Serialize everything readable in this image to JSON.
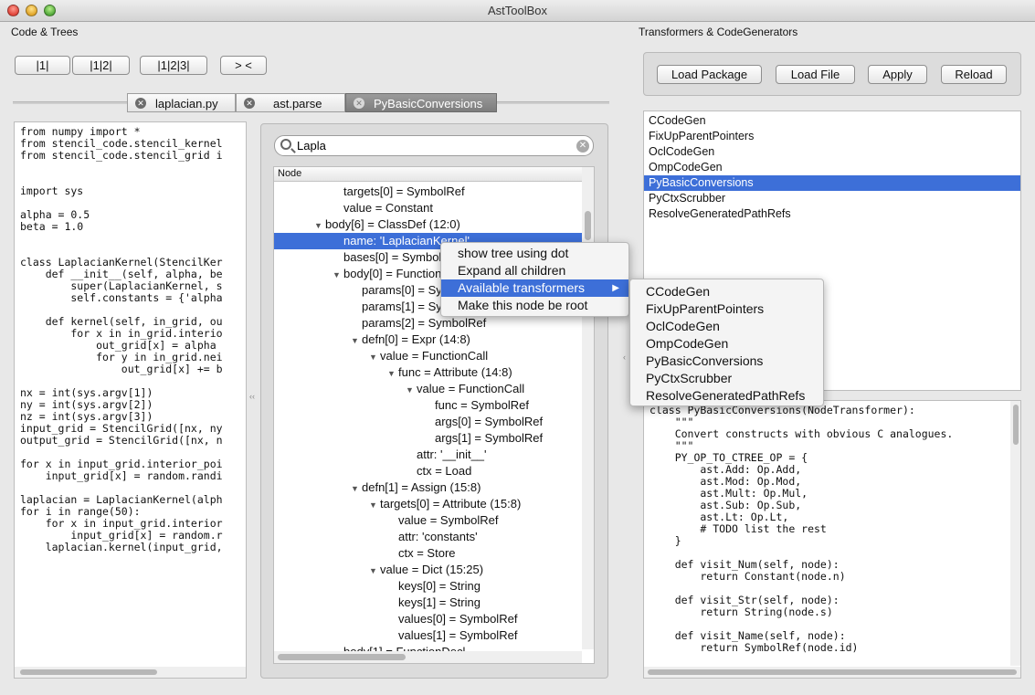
{
  "window": {
    "title": "AstToolBox"
  },
  "left": {
    "label": "Code & Trees",
    "buttons": [
      "|1|",
      "|1|2|",
      "|1|2|3|",
      ">  <"
    ],
    "tabs": [
      {
        "label": "laplacian.py",
        "active": false
      },
      {
        "label": "ast.parse",
        "active": false
      },
      {
        "label": "PyBasicConversions",
        "active": true
      }
    ],
    "code_lines": [
      "from numpy import *",
      "from stencil_code.stencil_kernel",
      "from stencil_code.stencil_grid i",
      "",
      "",
      "import sys",
      "",
      "alpha = 0.5",
      "beta = 1.0",
      "",
      "",
      "class LaplacianKernel(StencilKer",
      "    def __init__(self, alpha, be",
      "        super(LaplacianKernel, s",
      "        self.constants = {'alpha",
      "",
      "    def kernel(self, in_grid, ou",
      "        for x in in_grid.interio",
      "            out_grid[x] = alpha ",
      "            for y in in_grid.nei",
      "                out_grid[x] += b",
      "",
      "nx = int(sys.argv[1])",
      "ny = int(sys.argv[2])",
      "nz = int(sys.argv[3])",
      "input_grid = StencilGrid([nx, ny",
      "output_grid = StencilGrid([nx, n",
      "",
      "for x in input_grid.interior_poi",
      "    input_grid[x] = random.randi",
      "",
      "laplacian = LaplacianKernel(alph",
      "for i in range(50):",
      "    for x in input_grid.interior",
      "        input_grid[x] = random.r",
      "    laplacian.kernel(input_grid,"
    ]
  },
  "tree": {
    "search_value": "Lapla",
    "header": "Node",
    "rows": [
      {
        "text": "targets[0] = SymbolRef",
        "indent": 4,
        "toggle": ""
      },
      {
        "text": "value = Constant",
        "indent": 4,
        "toggle": ""
      },
      {
        "text": "body[6] = ClassDef (12:0)",
        "indent": 3,
        "toggle": "▼"
      },
      {
        "text": "name: 'LaplacianKernel'",
        "indent": 4,
        "toggle": "",
        "selected": true
      },
      {
        "text": "bases[0] = SymbolRef",
        "indent": 4,
        "toggle": ""
      },
      {
        "text": "body[0] = FunctionDecl",
        "indent": 4,
        "toggle": "▼"
      },
      {
        "text": "params[0] = SymbolRef",
        "indent": 5,
        "toggle": ""
      },
      {
        "text": "params[1] = SymbolRef",
        "indent": 5,
        "toggle": ""
      },
      {
        "text": "params[2] = SymbolRef",
        "indent": 5,
        "toggle": ""
      },
      {
        "text": "defn[0] = Expr (14:8)",
        "indent": 5,
        "toggle": "▼"
      },
      {
        "text": "value = FunctionCall",
        "indent": 6,
        "toggle": "▼"
      },
      {
        "text": "func = Attribute (14:8)",
        "indent": 7,
        "toggle": "▼"
      },
      {
        "text": "value = FunctionCall",
        "indent": 8,
        "toggle": "▼"
      },
      {
        "text": "func = SymbolRef",
        "indent": 9,
        "toggle": ""
      },
      {
        "text": "args[0] = SymbolRef",
        "indent": 9,
        "toggle": ""
      },
      {
        "text": "args[1] = SymbolRef",
        "indent": 9,
        "toggle": ""
      },
      {
        "text": "attr: '__init__'",
        "indent": 8,
        "toggle": ""
      },
      {
        "text": "ctx = Load",
        "indent": 8,
        "toggle": ""
      },
      {
        "text": "defn[1] = Assign (15:8)",
        "indent": 5,
        "toggle": "▼"
      },
      {
        "text": "targets[0] = Attribute (15:8)",
        "indent": 6,
        "toggle": "▼"
      },
      {
        "text": "value = SymbolRef",
        "indent": 7,
        "toggle": ""
      },
      {
        "text": "attr: 'constants'",
        "indent": 7,
        "toggle": ""
      },
      {
        "text": "ctx = Store",
        "indent": 7,
        "toggle": ""
      },
      {
        "text": "value = Dict (15:25)",
        "indent": 6,
        "toggle": "▼"
      },
      {
        "text": "keys[0] = String",
        "indent": 7,
        "toggle": ""
      },
      {
        "text": "keys[1] = String",
        "indent": 7,
        "toggle": ""
      },
      {
        "text": "values[0] = SymbolRef",
        "indent": 7,
        "toggle": ""
      },
      {
        "text": "values[1] = SymbolRef",
        "indent": 7,
        "toggle": ""
      },
      {
        "text": "body[1] = FunctionDecl",
        "indent": 4,
        "toggle": ""
      }
    ]
  },
  "context_menu": {
    "items": [
      "show tree using dot",
      "Expand all children",
      "Available transformers",
      "Make this node be root"
    ],
    "highlighted": "Available transformers",
    "submenu": [
      "CCodeGen",
      "FixUpParentPointers",
      "OclCodeGen",
      "OmpCodeGen",
      "PyBasicConversions",
      "PyCtxScrubber",
      "ResolveGeneratedPathRefs"
    ]
  },
  "right": {
    "label": "Transformers & CodeGenerators",
    "buttons": [
      "Load Package",
      "Load File",
      "Apply",
      "Reload"
    ],
    "transformers": [
      "CCodeGen",
      "FixUpParentPointers",
      "OclCodeGen",
      "OmpCodeGen",
      "PyBasicConversions",
      "PyCtxScrubber",
      "ResolveGeneratedPathRefs"
    ],
    "selected_transformer": "PyBasicConversions",
    "code_lines": [
      "class PyBasicConversions(NodeTransformer):",
      "    \"\"\"",
      "    Convert constructs with obvious C analogues.",
      "    \"\"\"",
      "    PY_OP_TO_CTREE_OP = {",
      "        ast.Add: Op.Add,",
      "        ast.Mod: Op.Mod,",
      "        ast.Mult: Op.Mul,",
      "        ast.Sub: Op.Sub,",
      "        ast.Lt: Op.Lt,",
      "        # TODO list the rest",
      "    }",
      "",
      "    def visit_Num(self, node):",
      "        return Constant(node.n)",
      "",
      "    def visit_Str(self, node):",
      "        return String(node.s)",
      "",
      "    def visit_Name(self, node):",
      "        return SymbolRef(node.id)"
    ]
  }
}
